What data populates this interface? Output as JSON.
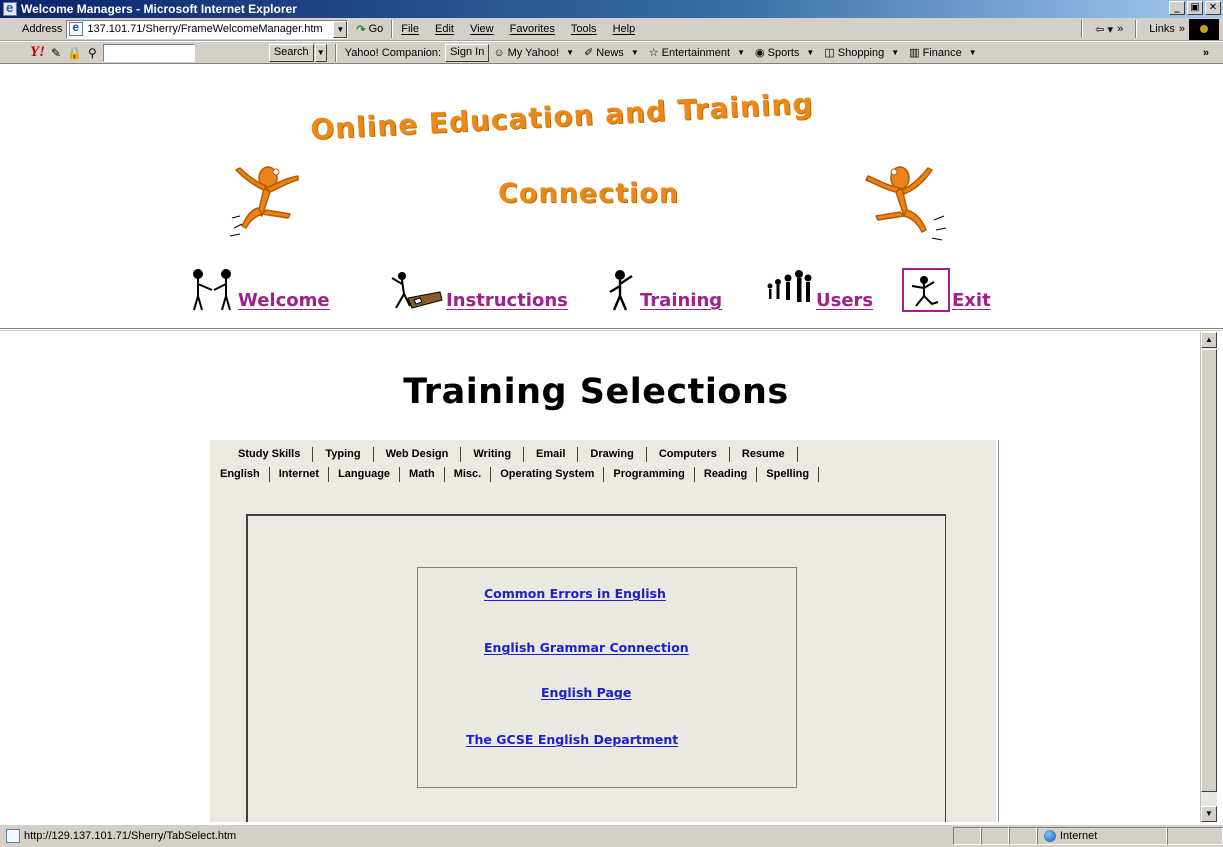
{
  "window": {
    "title": "Welcome Managers - Microsoft Internet Explorer",
    "controls": {
      "minimize": "_",
      "maximize": "▣",
      "close": "✕"
    }
  },
  "menubar": {
    "address_label": "Address",
    "address_value": "137.101.71/Sherry/FrameWelcomeManager.htm",
    "go_label": "Go",
    "menus": [
      "File",
      "Edit",
      "View",
      "Favorites",
      "Tools",
      "Help"
    ],
    "links_label": "Links"
  },
  "yahoo_toolbar": {
    "logo": "Y!",
    "search_button": "Search",
    "companion_label": "Yahoo! Companion:",
    "sign_in": "Sign In",
    "links": [
      "My Yahoo!",
      "News",
      "Entertainment",
      "Sports",
      "Shopping",
      "Finance"
    ],
    "more": "»"
  },
  "banner": {
    "line1": "Online Education and Training",
    "line2": "Connection"
  },
  "nav": {
    "items": [
      "Welcome",
      "Instructions",
      "Training",
      "Users",
      "Exit"
    ]
  },
  "main": {
    "heading": "Training Selections",
    "tabs_row1": [
      "Study Skills",
      "Typing",
      "Web Design",
      "Writing",
      "Email",
      "Drawing",
      "Computers",
      "Resume"
    ],
    "tabs_row2": [
      "English",
      "Internet",
      "Language",
      "Math",
      "Misc.",
      "Operating System",
      "Programming",
      "Reading",
      "Spelling"
    ],
    "active_tab": "English",
    "links": [
      "Common Errors in English",
      "English Grammar Connection",
      "English Page",
      "The GCSE English Department"
    ]
  },
  "status": {
    "url": "http://129.137.101.71/Sherry/TabSelect.htm",
    "zone": "Internet"
  },
  "colors": {
    "nav_link": "#a0208c",
    "banner": "#e88a1a",
    "content_link": "#1a22c8",
    "panel_bg": "#ece9e2"
  }
}
